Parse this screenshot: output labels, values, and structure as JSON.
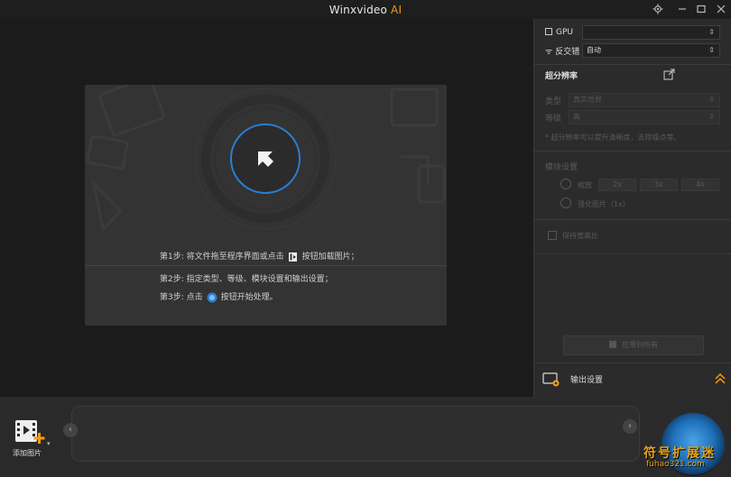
{
  "window": {
    "title": "Winxvideo",
    "title_ai": "AI"
  },
  "colors": {
    "accent": "#f39c12",
    "brand_blue": "#2a7fd4",
    "background": "#1b1b1b",
    "panel": "#2b2b2b"
  },
  "drop_panel": {
    "step1_before": "第1步: 将文件拖至程序界面或点击",
    "step1_after": "按钮加载图片；",
    "step2": "第2步: 指定类型、等级、模块设置和输出设置；",
    "step3_before": "第3步: 点击",
    "step3_after": "按钮开始处理。"
  },
  "right_panel": {
    "gpu_label": "GPU",
    "gpu_value": "",
    "deinterlace_label": "反交错",
    "deinterlace_value": "自动",
    "super_resolution_label": "超分辨率",
    "type_label": "类型",
    "type_value": "真实世界",
    "level_label": "等级",
    "level_value": "高",
    "note": "* 超分辨率可以提升清晰度，去除噪点等。",
    "module_settings_label": "模块设置",
    "scale_label": "缩放",
    "scale_options": [
      "2x",
      "3x",
      "4x"
    ],
    "optimize_label": "强化图片（1x）",
    "keep_aspect_label": "保持宽高比",
    "apply_all_label": "应用到所有",
    "output_settings_label": "输出设置"
  },
  "bottom": {
    "add_image_label": "添加图片"
  },
  "watermark": {
    "text": "符号扩展迷",
    "sub": "fuhao321.com"
  }
}
